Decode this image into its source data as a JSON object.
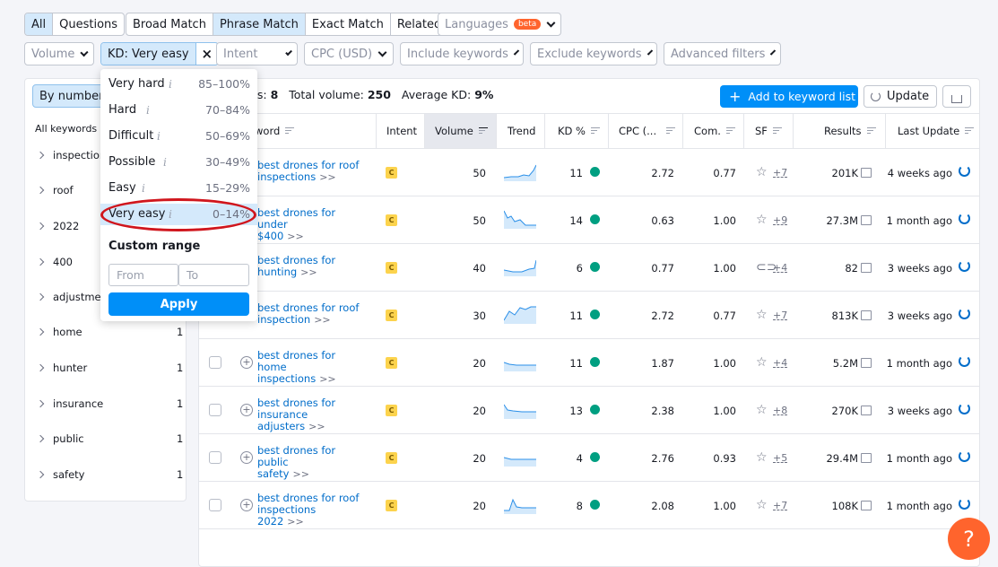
{
  "tabs1": [
    "All",
    "Questions"
  ],
  "tabs2": [
    "Broad Match",
    "Phrase Match",
    "Exact Match",
    "Related"
  ],
  "languages": {
    "label": "Languages",
    "badge": "beta"
  },
  "filters": {
    "volume": "Volume",
    "kd": "KD: Very easy",
    "kd_clear": "×",
    "intent": "Intent",
    "cpc": "CPC (USD)",
    "include": "Include keywords",
    "exclude": "Exclude keywords",
    "advanced": "Advanced filters"
  },
  "sidebar": {
    "by_number": "By number",
    "all_keywords": "All keywords",
    "items": [
      {
        "label": "inspection",
        "count": ""
      },
      {
        "label": "roof",
        "count": ""
      },
      {
        "label": "2022",
        "count": ""
      },
      {
        "label": "400",
        "count": ""
      },
      {
        "label": "adjustment",
        "count": ""
      },
      {
        "label": "home",
        "count": "1"
      },
      {
        "label": "hunter",
        "count": "1"
      },
      {
        "label": "insurance",
        "count": "1"
      },
      {
        "label": "public",
        "count": "1"
      },
      {
        "label": "safety",
        "count": "1"
      }
    ]
  },
  "summary": {
    "words_label": "rds:",
    "words_value": "8",
    "volume_label": "Total volume:",
    "volume_value": "250",
    "kd_label": "Average KD:",
    "kd_value": "9%"
  },
  "actions": {
    "add": "Add to keyword list",
    "update": "Update"
  },
  "columns": [
    "word",
    "Intent",
    "Volume",
    "Trend",
    "KD %",
    "CPC (...",
    "Com.",
    "SF",
    "Results",
    "Last Update"
  ],
  "rows": [
    {
      "kw1": "best drones for roof",
      "kw2": "inspections",
      "intent": "C",
      "volume": "50",
      "kd": "11",
      "cpc": "2.72",
      "com": "0.77",
      "sf": "+7",
      "results": "201K",
      "updated": "4 weeks ago",
      "sf_icon": "star"
    },
    {
      "kw1": "best drones for under",
      "kw2": "$400",
      "intent": "C",
      "volume": "50",
      "kd": "14",
      "cpc": "0.63",
      "com": "1.00",
      "sf": "+9",
      "results": "27.3M",
      "updated": "1 month ago",
      "sf_icon": "star"
    },
    {
      "kw1": "best drones for",
      "kw2": "hunting",
      "intent": "C",
      "volume": "40",
      "kd": "6",
      "cpc": "0.77",
      "com": "1.00",
      "sf": "+4",
      "results": "82",
      "updated": "3 weeks ago",
      "sf_icon": "link"
    },
    {
      "kw1": "best drones for roof",
      "kw2": "inspection",
      "intent": "C",
      "volume": "30",
      "kd": "11",
      "cpc": "2.72",
      "com": "0.77",
      "sf": "+7",
      "results": "813K",
      "updated": "3 weeks ago",
      "sf_icon": "star"
    },
    {
      "kw1": "best drones for home",
      "kw2": "inspections",
      "intent": "C",
      "volume": "20",
      "kd": "11",
      "cpc": "1.87",
      "com": "1.00",
      "sf": "+4",
      "results": "5.2M",
      "updated": "1 month ago",
      "sf_icon": "star"
    },
    {
      "kw1": "best drones for",
      "kw2": "insurance adjusters",
      "intent": "C",
      "volume": "20",
      "kd": "13",
      "cpc": "2.38",
      "com": "1.00",
      "sf": "+8",
      "results": "270K",
      "updated": "3 weeks ago",
      "sf_icon": "star"
    },
    {
      "kw1": "best drones for public",
      "kw2": "safety",
      "intent": "C",
      "volume": "20",
      "kd": "4",
      "cpc": "2.76",
      "com": "0.93",
      "sf": "+5",
      "results": "29.4M",
      "updated": "1 month ago",
      "sf_icon": "star"
    },
    {
      "kw1": "best drones for roof",
      "kw2": "inspections 2022",
      "intent": "C",
      "volume": "20",
      "kd": "8",
      "cpc": "2.08",
      "com": "1.00",
      "sf": "+7",
      "results": "108K",
      "updated": "1 month ago",
      "sf_icon": "star"
    }
  ],
  "dropdown": {
    "options": [
      {
        "name": "Very hard",
        "range": "85–100%"
      },
      {
        "name": "Hard",
        "range": "70–84%"
      },
      {
        "name": "Difficult",
        "range": "50–69%"
      },
      {
        "name": "Possible",
        "range": "30–49%"
      },
      {
        "name": "Easy",
        "range": "15–29%"
      },
      {
        "name": "Very easy",
        "range": "0–14%"
      }
    ],
    "custom_range": "Custom range",
    "from_placeholder": "From",
    "to_placeholder": "To",
    "apply": "Apply"
  },
  "help": "?",
  "colors": {
    "accent": "#008ff8",
    "kd_dot": "#009f81",
    "highlight": "#d0161d",
    "help": "#ff642d"
  }
}
